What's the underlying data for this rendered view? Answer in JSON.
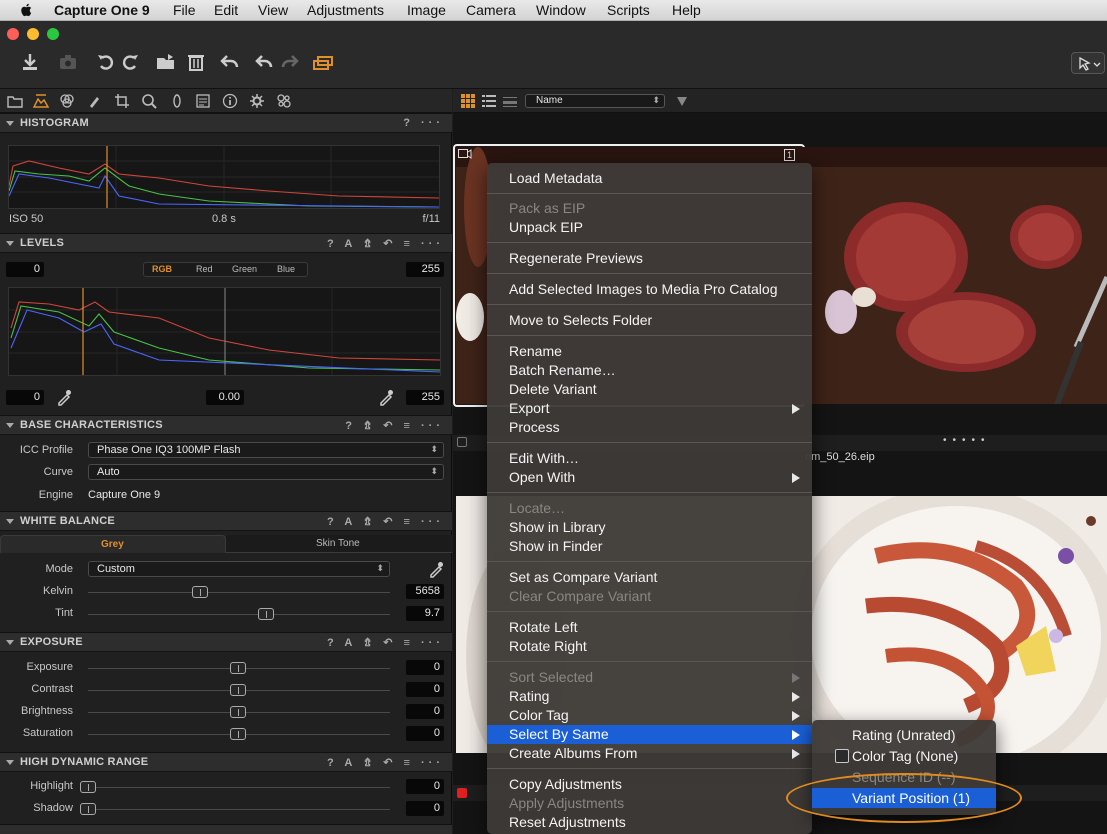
{
  "menubar": {
    "app": "Capture One 9",
    "items": [
      "File",
      "Edit",
      "View",
      "Adjustments",
      "Image",
      "Camera",
      "Window",
      "Scripts",
      "Help"
    ]
  },
  "histogram": {
    "title": "HISTOGRAM",
    "icons": "? ···",
    "iso": "ISO 50",
    "shutter": "0.8 s",
    "aperture": "f/11"
  },
  "levels": {
    "title": "LEVELS",
    "icons": "? A ⇯ ↶ ≡ ···",
    "input_low": "0",
    "input_high": "255",
    "channels": [
      "RGB",
      "Red",
      "Green",
      "Blue"
    ],
    "output_low": "0",
    "gamma": "0.00",
    "output_high": "255"
  },
  "base": {
    "title": "BASE CHARACTERISTICS",
    "icons": "? ⇯ ↶ ≡ ···",
    "icc_label": "ICC Profile",
    "icc_value": "Phase One IQ3 100MP Flash",
    "curve_label": "Curve",
    "curve_value": "Auto",
    "engine_label": "Engine",
    "engine_value": "Capture One 9"
  },
  "white_balance": {
    "title": "WHITE BALANCE",
    "icons": "? A ⇯ ↶ ≡ ···",
    "tabs": [
      "Grey",
      "Skin Tone"
    ],
    "mode_label": "Mode",
    "mode_value": "Custom",
    "kelvin_label": "Kelvin",
    "kelvin_value": "5658",
    "kelvin_level": 0.37,
    "tint_label": "Tint",
    "tint_value": "9.7",
    "tint_level": 0.59
  },
  "exposure": {
    "title": "EXPOSURE",
    "icons": "? A ⇯ ↶ ≡ ···",
    "rows": [
      {
        "label": "Exposure",
        "value": "0"
      },
      {
        "label": "Contrast",
        "value": "0"
      },
      {
        "label": "Brightness",
        "value": "0"
      },
      {
        "label": "Saturation",
        "value": "0"
      }
    ]
  },
  "hdr": {
    "title": "HIGH DYNAMIC RANGE",
    "icons": "? A ⇯ ↶ ≡ ···",
    "rows": [
      {
        "label": "Highlight",
        "value": "0"
      },
      {
        "label": "Shadow",
        "value": "0"
      }
    ]
  },
  "browser": {
    "sort_value": "Name",
    "thumb1_badge": "1",
    "thumb1_filename": "nm_50_26.eip"
  },
  "context_menu": {
    "load_metadata": "Load Metadata",
    "pack_eip": "Pack as EIP",
    "unpack_eip": "Unpack EIP",
    "regen_previews": "Regenerate Previews",
    "add_media_pro": "Add Selected Images to Media Pro Catalog",
    "move_selects": "Move to Selects Folder",
    "rename": "Rename",
    "batch_rename": "Batch Rename…",
    "delete_variant": "Delete Variant",
    "export": "Export",
    "process": "Process",
    "edit_with": "Edit With…",
    "open_with": "Open With",
    "locate": "Locate…",
    "show_library": "Show in Library",
    "show_finder": "Show in Finder",
    "set_compare": "Set as Compare Variant",
    "clear_compare": "Clear Compare Variant",
    "rotate_left": "Rotate Left",
    "rotate_right": "Rotate Right",
    "sort_selected": "Sort Selected",
    "rating": "Rating",
    "color_tag": "Color Tag",
    "select_by_same": "Select By Same",
    "create_albums": "Create Albums From",
    "copy_adj": "Copy Adjustments",
    "apply_adj": "Apply Adjustments",
    "reset_adj": "Reset Adjustments"
  },
  "submenu": {
    "rating": "Rating (Unrated)",
    "color_tag": "Color Tag (None)",
    "sequence": "Sequence ID (--)",
    "variant": "Variant Position (1)"
  },
  "colors": {
    "highlight": "#1a5fd6",
    "annotation": "#e18b1f",
    "accent_tool": "#e0902a"
  }
}
